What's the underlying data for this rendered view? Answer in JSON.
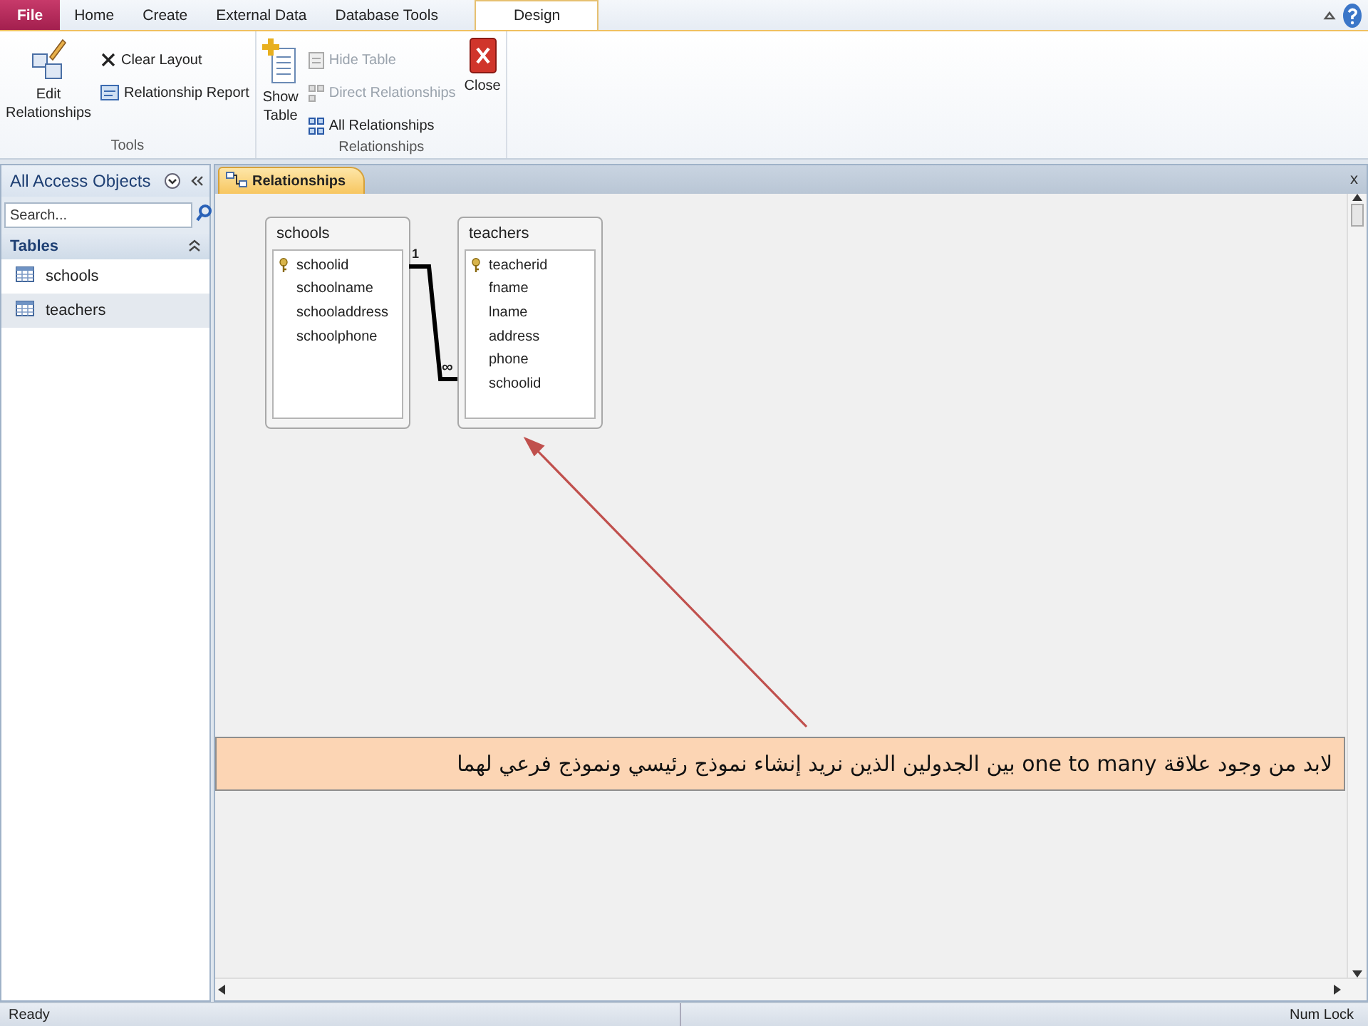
{
  "ribbon_tabs": [
    {
      "label": "File",
      "kind": "file",
      "selected": false
    },
    {
      "label": "Home",
      "kind": "tab",
      "selected": false
    },
    {
      "label": "Create",
      "kind": "tab",
      "selected": false
    },
    {
      "label": "External Data",
      "kind": "tab",
      "selected": false
    },
    {
      "label": "Database Tools",
      "kind": "tab",
      "selected": false
    },
    {
      "label": "Design",
      "kind": "tab",
      "selected": true
    }
  ],
  "ribbon_groups": [
    {
      "label": "Tools",
      "buttons": [
        {
          "label": "Edit Relationships",
          "kind": "large",
          "disabled": false
        },
        {
          "label": "Clear Layout",
          "kind": "small",
          "disabled": false
        },
        {
          "label": "Relationship Report",
          "kind": "small",
          "disabled": false
        }
      ]
    },
    {
      "label": "Relationships",
      "buttons": [
        {
          "label": "Show Table",
          "kind": "large",
          "disabled": false
        },
        {
          "label": "Hide Table",
          "kind": "small",
          "disabled": true
        },
        {
          "label": "Direct Relationships",
          "kind": "small",
          "disabled": true
        },
        {
          "label": "All Relationships",
          "kind": "small",
          "disabled": false
        },
        {
          "label": "Close",
          "kind": "large",
          "disabled": false
        }
      ]
    }
  ],
  "nav_pane": {
    "title": "All Access Objects",
    "search": {
      "placeholder": "Search..."
    },
    "group": {
      "label": "Tables",
      "expanded": true
    },
    "items": [
      {
        "label": "schools",
        "selected": false
      },
      {
        "label": "teachers",
        "selected": true
      }
    ]
  },
  "document_tab": {
    "label": "Relationships",
    "close": "x"
  },
  "tables": [
    {
      "name": "schools",
      "fields": [
        {
          "name": "schoolid",
          "primary_key": true
        },
        {
          "name": "schoolname",
          "primary_key": false
        },
        {
          "name": "schooladdress",
          "primary_key": false
        },
        {
          "name": "schoolphone",
          "primary_key": false
        }
      ]
    },
    {
      "name": "teachers",
      "fields": [
        {
          "name": "teacherid",
          "primary_key": true
        },
        {
          "name": "fname",
          "primary_key": false
        },
        {
          "name": "lname",
          "primary_key": false
        },
        {
          "name": "address",
          "primary_key": false
        },
        {
          "name": "phone",
          "primary_key": false
        },
        {
          "name": "schoolid",
          "primary_key": false
        }
      ]
    }
  ],
  "relationship": {
    "one_label": "1",
    "many_label": "∞"
  },
  "callout": "لابد من وجود علاقة one to many بين الجدولين الذين نريد إنشاء نموذج رئيسي ونموذج فرعي لهما",
  "status_bar": {
    "left": "Ready",
    "right": "Num Lock"
  }
}
